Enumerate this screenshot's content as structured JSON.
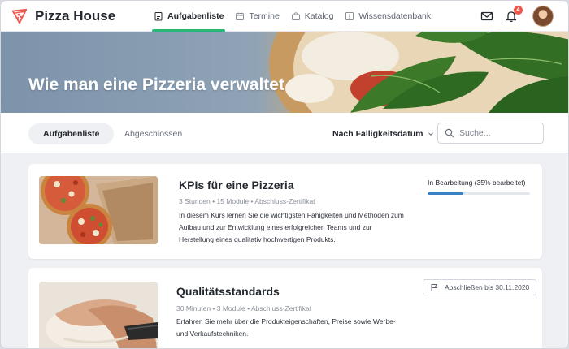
{
  "app": {
    "name": "Pizza House",
    "logo_icon": "pizza-slice-icon",
    "accent": "#2bb673"
  },
  "nav": {
    "items": [
      {
        "label": "Aufgabenliste",
        "icon": "clipboard-icon",
        "active": true
      },
      {
        "label": "Termine",
        "icon": "calendar-icon",
        "active": false
      },
      {
        "label": "Katalog",
        "icon": "bag-icon",
        "active": false
      },
      {
        "label": "Wissensdatenbank",
        "icon": "info-icon",
        "active": false
      }
    ]
  },
  "header_right": {
    "notifications_count": "4",
    "mail_icon": "mail-icon",
    "bell_icon": "bell-icon"
  },
  "hero": {
    "title": "Wie man eine Pizzeria verwaltet"
  },
  "filters": {
    "tabs": [
      "Aufgabenliste",
      "Abgeschlossen"
    ],
    "sort_label": "Nach Fälligkeitsdatum",
    "search_placeholder": "Suche..."
  },
  "courses": [
    {
      "title": "KPIs für eine Pizzeria",
      "meta": "3 Stunden • 15 Module  •  Abschluss-Zertifikat",
      "description": "In diesem Kurs lernen Sie die wichtigsten Fähigkeiten und Methoden zum Aufbau und zur Entwicklung eines erfolgreichen Teams und zur Herstellung eines qualitativ hochwertigen Produkts.",
      "status": "In Bearbeitung (35% bearbeitet)",
      "progress": 0.35,
      "progress_color": "#3b82c4"
    },
    {
      "title": "Qualitätsstandards",
      "meta": "30 Minuten • 3 Module  •  Abschluss-Zertifikat",
      "description": "Erfahren Sie mehr über die Produkteigenschaften, Preise sowie Werbe- und Verkaufstechniken.",
      "deadline": "Abschließen bis 30.11.2020"
    }
  ]
}
